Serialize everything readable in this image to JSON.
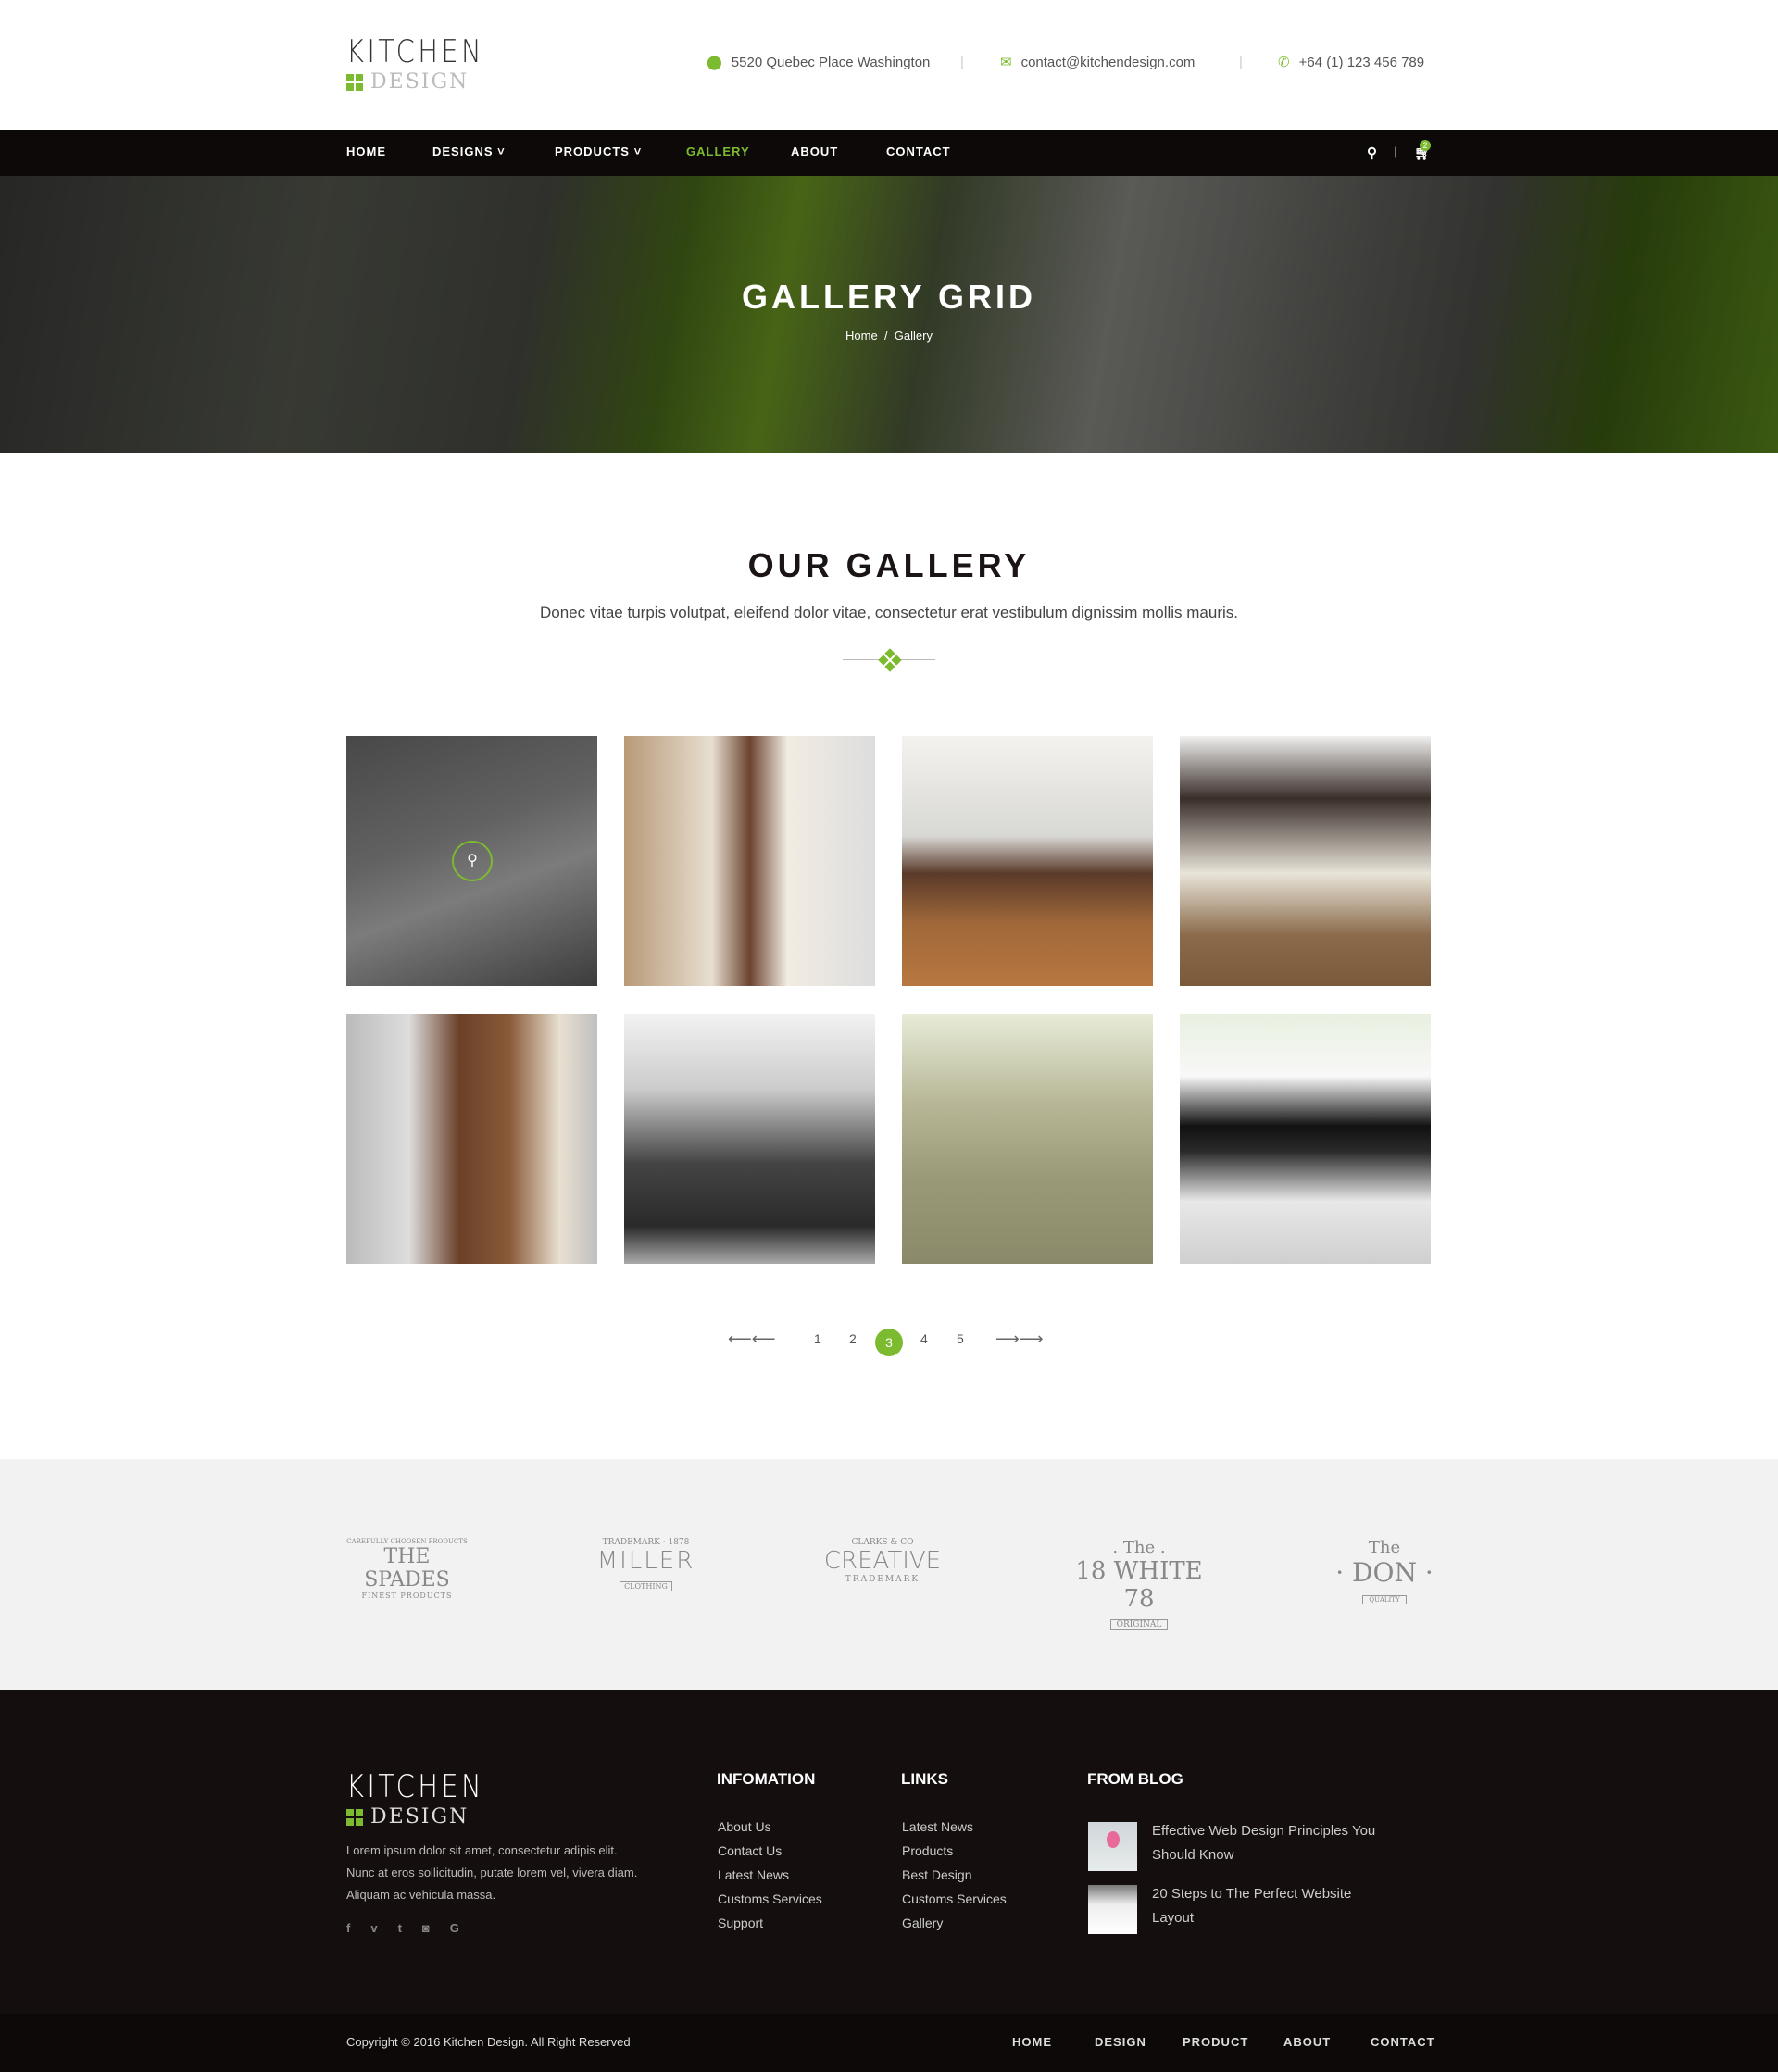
{
  "header": {
    "logo_top": "KITCHEN",
    "logo_bottom": "DESIGN",
    "address": "5520 Quebec Place Washington",
    "email": "contact@kitchendesign.com",
    "phone": "+64 (1) 123 456 789"
  },
  "nav": {
    "items": [
      "HOME",
      "DESIGNS",
      "PRODUCTS",
      "GALLERY",
      "ABOUT",
      "CONTACT"
    ],
    "active": "GALLERY",
    "cart_count": "2"
  },
  "hero": {
    "title": "GALLERY GRID",
    "breadcrumb": [
      "Home",
      "/",
      "Gallery"
    ]
  },
  "gallery": {
    "title": "OUR GALLERY",
    "subtitle": "Donec vitae turpis volutpat, eleifend dolor vitae, consectetur erat vestibulum dignissim mollis mauris."
  },
  "pagination": {
    "pages": [
      "1",
      "2",
      "3",
      "4",
      "5"
    ],
    "current": "3"
  },
  "brands": [
    {
      "top": "CAREFULLY CHOOSEN PRODUCTS",
      "main": "THE SPADES",
      "bottom": "FINEST PRODUCTS"
    },
    {
      "top": "TRADEMARK · 1878",
      "main": "MILLER",
      "bottom": "CLOTHING"
    },
    {
      "top": "CLARKS & CO",
      "main": "CREATIVE",
      "bottom": "TRADEMARK"
    },
    {
      "top": ". The .",
      "main": "18 WHITE 78",
      "bottom": "ORIGINAL"
    },
    {
      "top": "The",
      "main": "· DON ·",
      "bottom": "QUALITY"
    }
  ],
  "footer": {
    "logo_top": "KITCHEN",
    "logo_bottom": "DESIGN",
    "about": "Lorem ipsum dolor sit amet, consectetur adipis elit. Nunc at eros sollicitudin, putate lorem vel, vivera diam. Aliquam ac vehicula massa.",
    "social": [
      "f",
      "v",
      "t",
      "ig",
      "G"
    ],
    "info_title": "INFOMATION",
    "info_links": [
      "About Us",
      "Contact Us",
      "Latest News",
      "Customs Services",
      "Support"
    ],
    "links_title": "LINKS",
    "links": [
      "Latest News",
      "Products",
      "Best Design",
      "Customs Services",
      "Gallery"
    ],
    "blog_title": "FROM BLOG",
    "blog": [
      "Effective Web Design Principles You Should Know",
      "20 Steps to The Perfect Website Layout"
    ],
    "copyright": "Copyright © 2016 Kitchen Design. All Right Reserved",
    "bottom_links": [
      "HOME",
      "DESIGN",
      "PRODUCT",
      "ABOUT",
      "CONTACT"
    ]
  },
  "colors": {
    "accent": "#7cbb2f",
    "dark": "#150e0e"
  }
}
